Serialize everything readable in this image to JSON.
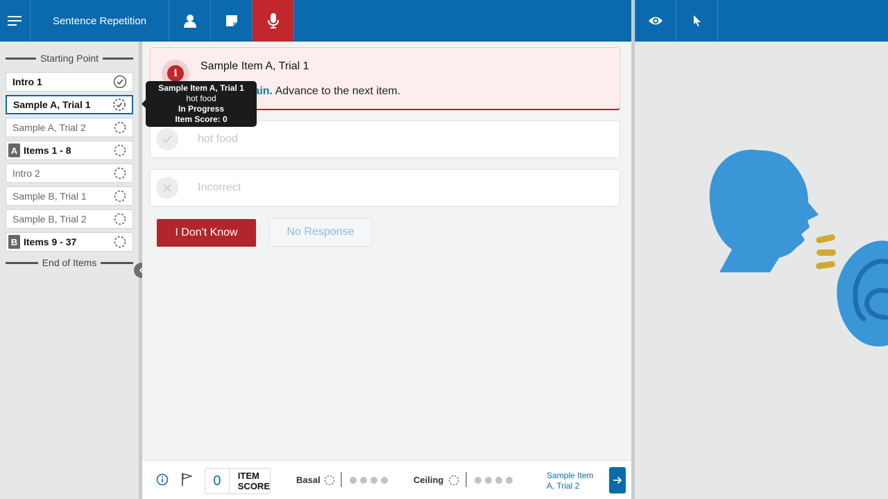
{
  "header": {
    "title": "Sentence Repetition",
    "icons": [
      "menu-icon",
      "person-icon",
      "note-icon",
      "microphone-icon",
      "eye-icon",
      "cursor-icon"
    ]
  },
  "colors": {
    "brand": "#0a6aad",
    "alert_red": "#c0282d",
    "accent_teal": "#167c9a"
  },
  "nav": {
    "start_label": "Starting Point",
    "end_label": "End of Items",
    "items": [
      {
        "label": "Intro 1",
        "status": "complete"
      },
      {
        "label": "Sample A, Trial 1",
        "status": "in-progress"
      },
      {
        "label": "Sample A, Trial 2",
        "status": "pending"
      },
      {
        "badge": "A",
        "label": "Items 1 - 8",
        "status": "pending"
      },
      {
        "label": "Intro 2",
        "status": "pending"
      },
      {
        "label": "Sample B, Trial 1",
        "status": "pending"
      },
      {
        "label": "Sample B, Trial 2",
        "status": "pending"
      },
      {
        "badge": "B",
        "label": "Items 9 - 37",
        "status": "pending"
      }
    ]
  },
  "tooltip": {
    "title": "Sample Item A, Trial 1",
    "response": "hot food",
    "status": "In Progress",
    "score": "Item Score: 0"
  },
  "alert": {
    "title": "Sample Item A, Trial 1",
    "highlight": "do that again.",
    "message": "Advance to the next item."
  },
  "responses": {
    "correct": "hot food",
    "incorrect": "Incorrect"
  },
  "buttons": {
    "dont_know": "I Don't Know",
    "no_response": "No Response"
  },
  "footer": {
    "item_score": "0",
    "item_score_label_1": "ITEM",
    "item_score_label_2": "SCORE",
    "basal_label": "Basal",
    "ceiling_label": "Ceiling",
    "next_item_line1": "Sample Item",
    "next_item_line2": "A, Trial 2"
  }
}
